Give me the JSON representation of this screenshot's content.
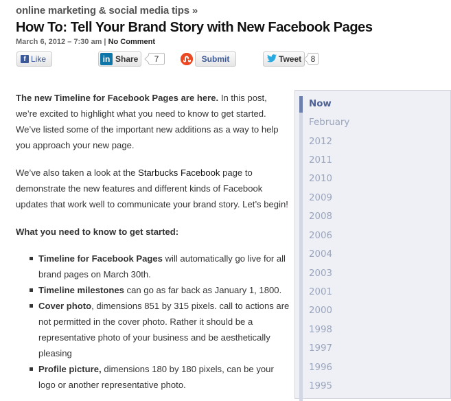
{
  "category": "online marketing & social media tips »",
  "title": "How To: Tell Your Brand Story with New Facebook Pages",
  "meta": {
    "date": "March 6, 2012 – 7:30 am",
    "separator": "|",
    "comments": "No Comment"
  },
  "share": {
    "facebook_logo": "f",
    "facebook_label": "Like",
    "linkedin_logo": "in",
    "linkedin_label": "Share",
    "linkedin_count": "7",
    "stumble_label": "Submit",
    "twitter_label": "Tweet",
    "twitter_count": "8"
  },
  "article": {
    "p1_bold": "The new Timeline for Facebook Pages are here.",
    "p1_rest": " In this post, we’re excited to highlight what you need to know to get started.  We’ve listed some of the important new additions as a way to help you approach your new page.",
    "p2_a": "We’ve also taken a look at the ",
    "p2_link": "Starbucks Facebook",
    "p2_b": " page to demonstrate the new features and different kinds of Facebook updates that work well to communicate your brand story. Let’s begin!",
    "section_heading": "What you need to know to get started:",
    "bullets": [
      {
        "bold": "Timeline for Facebook Pages",
        "text": " will automatically go live for all brand pages on March 30th."
      },
      {
        "bold": "Timeline milestones",
        "text": " can go as far back as January 1, 1800."
      },
      {
        "bold": "Cover photo",
        "text": ", dimensions 851 by 315 pixels. call to actions are not permitted in the cover photo. Rather it should be a representative photo of your business and be aesthetically pleasing"
      },
      {
        "bold": "Profile picture,",
        "text": " dimensions 180 by 180 pixels, can be your logo or another representative photo."
      }
    ]
  },
  "timeline": {
    "items": [
      "Now",
      "February",
      "2012",
      "2011",
      "2010",
      "2009",
      "2008",
      "2006",
      "2004",
      "2003",
      "2001",
      "2000",
      "1998",
      "1997",
      "1996",
      "1995"
    ]
  },
  "colors": {
    "accent": "#4e6296",
    "timeline_bg": "#eef0f5",
    "facebook": "#3b5998",
    "linkedin": "#0e76a8",
    "stumbleupon": "#eb4924",
    "twitter": "#2aa9e0"
  }
}
